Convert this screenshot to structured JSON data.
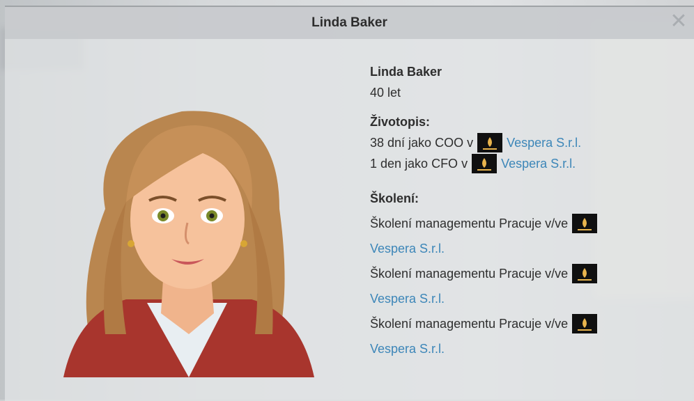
{
  "dialog": {
    "title": "Linda Baker",
    "close_glyph": "✕"
  },
  "person": {
    "name": "Linda Baker",
    "age": "40 let"
  },
  "cv": {
    "heading": "Životopis:",
    "items": [
      {
        "text": "38 dní jako COO v",
        "company": "Vespera S.r.l.",
        "logo_icon": "company-logo-icon"
      },
      {
        "text": "1 den jako CFO v",
        "company": "Vespera S.r.l.",
        "logo_icon": "company-logo-icon"
      }
    ]
  },
  "training": {
    "heading": "Školení:",
    "items": [
      {
        "text": "Školení managementu Pracuje v/ve",
        "company": "Vespera S.r.l.",
        "logo_icon": "company-logo-icon"
      },
      {
        "text": "Školení managementu Pracuje v/ve",
        "company": "Vespera S.r.l.",
        "logo_icon": "company-logo-icon"
      },
      {
        "text": "Školení managementu Pracuje v/ve",
        "company": "Vespera S.r.l.",
        "logo_icon": "company-logo-icon"
      }
    ]
  },
  "colors": {
    "link": "#3c86b8",
    "hair": "#b9864f",
    "jacket": "#a8352d"
  }
}
